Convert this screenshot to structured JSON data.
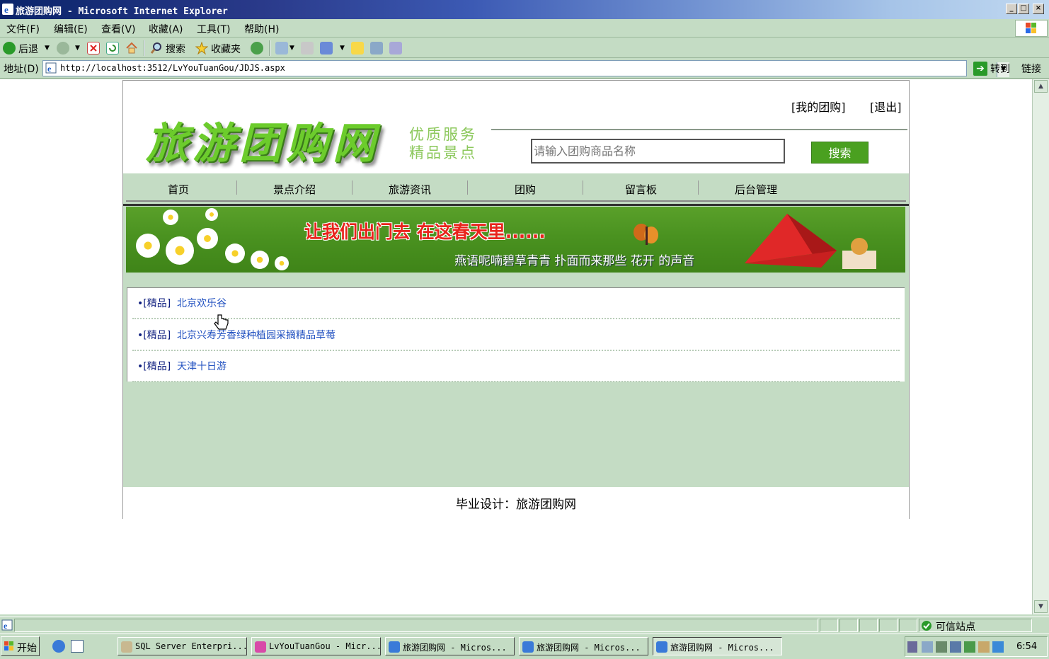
{
  "window": {
    "title": "旅游团购网 - Microsoft Internet Explorer",
    "minimize": "_",
    "maximize": "□",
    "close": "×"
  },
  "menu": [
    "文件(F)",
    "编辑(E)",
    "查看(V)",
    "收藏(A)",
    "工具(T)",
    "帮助(H)"
  ],
  "toolbar": {
    "back": "后退",
    "search": "搜索",
    "favorites": "收藏夹"
  },
  "address": {
    "label": "地址(D)",
    "url": "http://localhost:3512/LvYouTuanGou/JDJS.aspx",
    "go": "转到",
    "links": "链接"
  },
  "site": {
    "logo": "旅游团购网",
    "slogan_line1": "优质服务",
    "slogan_line2": "精品景点",
    "my_group": "[我的团购]",
    "logout": "[退出]",
    "search_placeholder": "请输入团购商品名称",
    "search_button": "搜索",
    "nav": [
      "首页",
      "景点介绍",
      "旅游资讯",
      "团购",
      "留言板",
      "后台管理"
    ],
    "banner_line1": "让我们出门去 在这春天里......",
    "banner_line2": "燕语呢喃碧草青青 扑面而来那些 花开 的声音",
    "items": [
      {
        "tag": "•[精品]",
        "title": "北京欢乐谷"
      },
      {
        "tag": "•[精品]",
        "title": "北京兴寿芳香绿种植园采摘精品草莓"
      },
      {
        "tag": "•[精品]",
        "title": "天津十日游"
      }
    ],
    "footer": "毕业设计：旅游团购网"
  },
  "status": {
    "zone": "可信站点"
  },
  "taskbar": {
    "start": "开始",
    "tasks": [
      "SQL Server Enterpri...",
      "LvYouTuanGou - Micr...",
      "旅游团购网 - Micros...",
      "旅游团购网 - Micros...",
      "旅游团购网 - Micros..."
    ],
    "clock": "6:54"
  }
}
